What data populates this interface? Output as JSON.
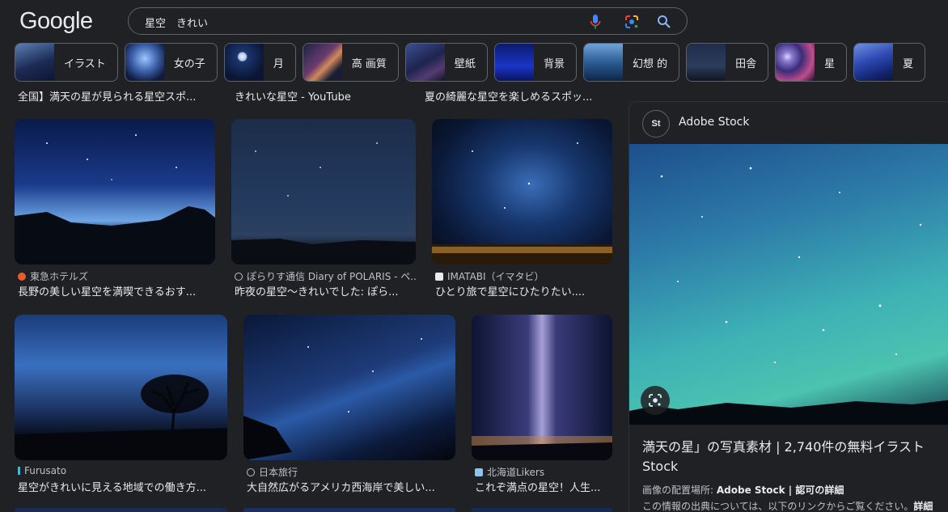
{
  "header": {
    "logo": "Google",
    "query": "星空　きれい"
  },
  "chips": [
    {
      "label": "イラスト"
    },
    {
      "label": "女の子"
    },
    {
      "label": "月"
    },
    {
      "label": "高 画質"
    },
    {
      "label": "壁紙"
    },
    {
      "label": "背景"
    },
    {
      "label": "幻想 的"
    },
    {
      "label": "田舎"
    },
    {
      "label": "星"
    },
    {
      "label": "夏"
    }
  ],
  "results": {
    "row0": [
      {
        "title": "全国】満天の星が見られる星空スポ..."
      },
      {
        "title": "きれいな星空 - YouTube"
      },
      {
        "title": "夏の綺麗な星空を楽しめるスポッ..."
      }
    ],
    "row1": [
      {
        "source": "東急ホテルズ",
        "title": "長野の美しい星空を満喫できるおす..."
      },
      {
        "source": "ぽらりす通信 Diary of POLARIS - ペ...",
        "title": "昨夜の星空〜きれいでした: ぽら..."
      },
      {
        "source": "IMATABI（イマタビ）",
        "title": "ひとり旅で星空にひたりたい...."
      }
    ],
    "row2": [
      {
        "source": "Furusato",
        "title": "星空がきれいに見える地域での働き方..."
      },
      {
        "source": "日本旅行",
        "title": "大自然広がるアメリカ西海岸で美しい..."
      },
      {
        "source": "北海道Likers",
        "title": "これぞ満点の星空！人生..."
      }
    ]
  },
  "panel": {
    "avatar": "St",
    "source": "Adobe Stock",
    "title": "満天の星」の写真素材 | 2,740件の無料イラスト Stock",
    "location_label": "画像の配置場所: ",
    "location_value": "Adobe Stock | 認可の詳細",
    "info_text": "この情報の出典については、以下のリンクからご覧ください。",
    "info_link": "詳細"
  },
  "colors": {
    "background": "#202124",
    "text": "#e8eaed",
    "muted": "#bdc1c6",
    "border": "#5f6368"
  }
}
